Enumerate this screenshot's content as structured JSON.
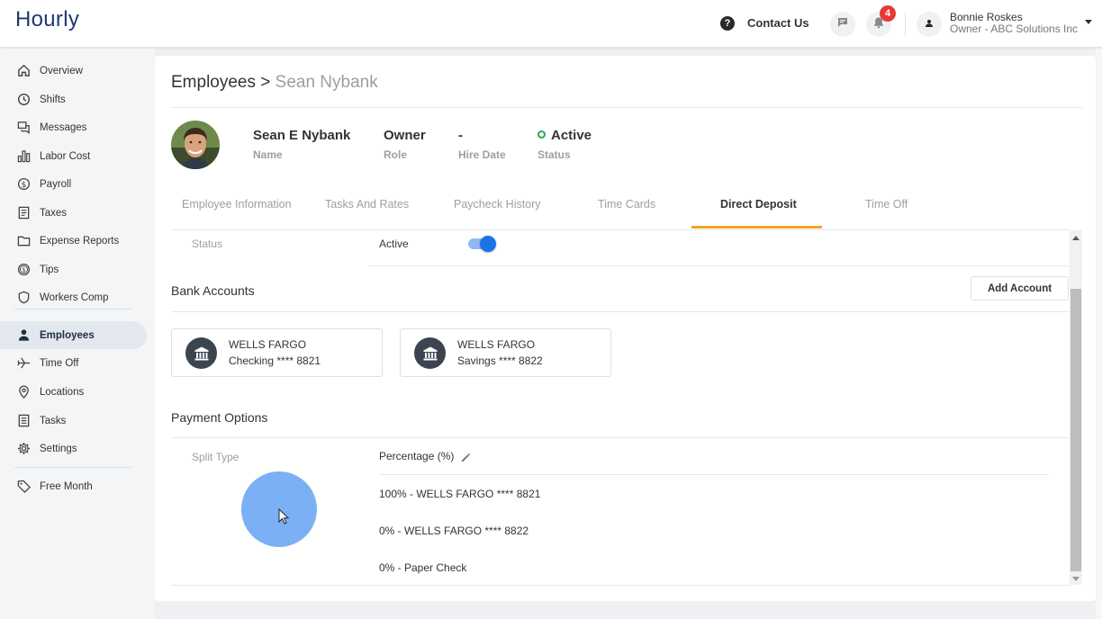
{
  "app": {
    "logo": "Hourly"
  },
  "header": {
    "contact_label": "Contact Us",
    "notification_count": "4",
    "user_name": "Bonnie Roskes",
    "user_role": "Owner - ABC Solutions Inc"
  },
  "sidebar": {
    "items": [
      {
        "label": "Overview",
        "icon": "home-icon"
      },
      {
        "label": "Shifts",
        "icon": "clock-icon"
      },
      {
        "label": "Messages",
        "icon": "messages-icon"
      },
      {
        "label": "Labor Cost",
        "icon": "bar-chart-icon"
      },
      {
        "label": "Payroll",
        "icon": "dollar-icon"
      },
      {
        "label": "Taxes",
        "icon": "document-icon"
      },
      {
        "label": "Expense Reports",
        "icon": "folder-icon"
      },
      {
        "label": "Tips",
        "icon": "coin-icon"
      },
      {
        "label": "Workers Comp",
        "icon": "shield-icon"
      },
      {
        "label": "Employees",
        "icon": "person-icon",
        "active": true
      },
      {
        "label": "Time Off",
        "icon": "airplane-icon"
      },
      {
        "label": "Locations",
        "icon": "location-pin-icon"
      },
      {
        "label": "Tasks",
        "icon": "task-list-icon"
      },
      {
        "label": "Settings",
        "icon": "gear-icon"
      },
      {
        "label": "Free Month",
        "icon": "tag-icon"
      }
    ]
  },
  "breadcrumb": {
    "parent": "Employees >",
    "current": "Sean Nybank"
  },
  "employee": {
    "name": "Sean E Nybank",
    "name_label": "Name",
    "role": "Owner",
    "role_label": "Role",
    "hire_date": "-",
    "hire_date_label": "Hire Date",
    "status": "Active",
    "status_label": "Status"
  },
  "tabs": [
    {
      "label": "Employee Information"
    },
    {
      "label": "Tasks And Rates"
    },
    {
      "label": "Paycheck History"
    },
    {
      "label": "Time Cards"
    },
    {
      "label": "Direct Deposit",
      "active": true
    },
    {
      "label": "Time Off"
    }
  ],
  "direct_deposit": {
    "status_label": "Status",
    "status_value": "Active",
    "status_toggle_on": true,
    "bank_accounts_title": "Bank Accounts",
    "add_account_label": "Add Account",
    "accounts": [
      {
        "bank": "WELLS FARGO",
        "account": "Checking **** 8821",
        "icon": "bank-icon"
      },
      {
        "bank": "WELLS FARGO",
        "account": "Savings **** 8822",
        "icon": "bank-icon"
      }
    ],
    "payment_options_title": "Payment Options",
    "split_type_label": "Split Type",
    "split_type_value": "Percentage (%)",
    "splits": [
      "100% - WELLS FARGO **** 8821",
      "0% - WELLS FARGO **** 8822",
      "0% - Paper Check"
    ]
  },
  "colors": {
    "brand": "#1e3a6e",
    "active_tab_underline": "#f5a623",
    "toggle_on": "#1a73e8",
    "status_active": "#34a853",
    "badge": "#e53935"
  }
}
